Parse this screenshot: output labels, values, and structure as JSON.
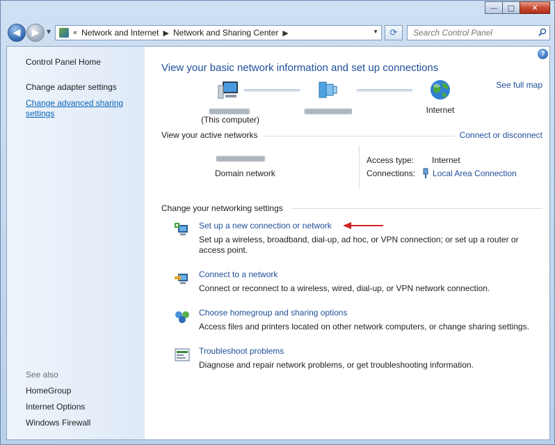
{
  "window": {
    "caption_buttons": {
      "minimize": "—",
      "maximize": "□",
      "close": "✕"
    }
  },
  "nav": {
    "back": "◀",
    "forward": "▶",
    "breadcrumb_overflow": "«",
    "breadcrumb": [
      "Network and Internet",
      "Network and Sharing Center"
    ],
    "breadcrumb_sep": "▶",
    "search_placeholder": "Search Control Panel"
  },
  "sidebar": {
    "home": "Control Panel Home",
    "links": [
      "Change adapter settings",
      "Change advanced sharing settings"
    ],
    "see_also_label": "See also",
    "see_also": [
      "HomeGroup",
      "Internet Options",
      "Windows Firewall"
    ]
  },
  "main": {
    "help": "?",
    "title": "View your basic network information and set up connections",
    "see_full_map": "See full map",
    "nodes": {
      "computer_sub": "(This computer)",
      "internet": "Internet"
    },
    "active_networks": {
      "heading": "View your active networks",
      "connect_link": "Connect or disconnect",
      "network_type": "Domain network",
      "access_type_label": "Access type:",
      "access_type_value": "Internet",
      "connections_label": "Connections:",
      "connections_value": "Local Area Connection"
    },
    "settings": {
      "heading": "Change your networking settings",
      "tasks": [
        {
          "link": "Set up a new connection or network",
          "desc": "Set up a wireless, broadband, dial-up, ad hoc, or VPN connection; or set up a router or access point.",
          "icon": "new-connection-icon"
        },
        {
          "link": "Connect to a network",
          "desc": "Connect or reconnect to a wireless, wired, dial-up, or VPN network connection.",
          "icon": "connect-network-icon"
        },
        {
          "link": "Choose homegroup and sharing options",
          "desc": "Access files and printers located on other network computers, or change sharing settings.",
          "icon": "homegroup-icon"
        },
        {
          "link": "Troubleshoot problems",
          "desc": "Diagnose and repair network problems, or get troubleshooting information.",
          "icon": "troubleshoot-icon"
        }
      ]
    }
  },
  "colors": {
    "link": "#1f4e99",
    "title": "#1f4e99",
    "annotation_arrow": "#d42020"
  }
}
